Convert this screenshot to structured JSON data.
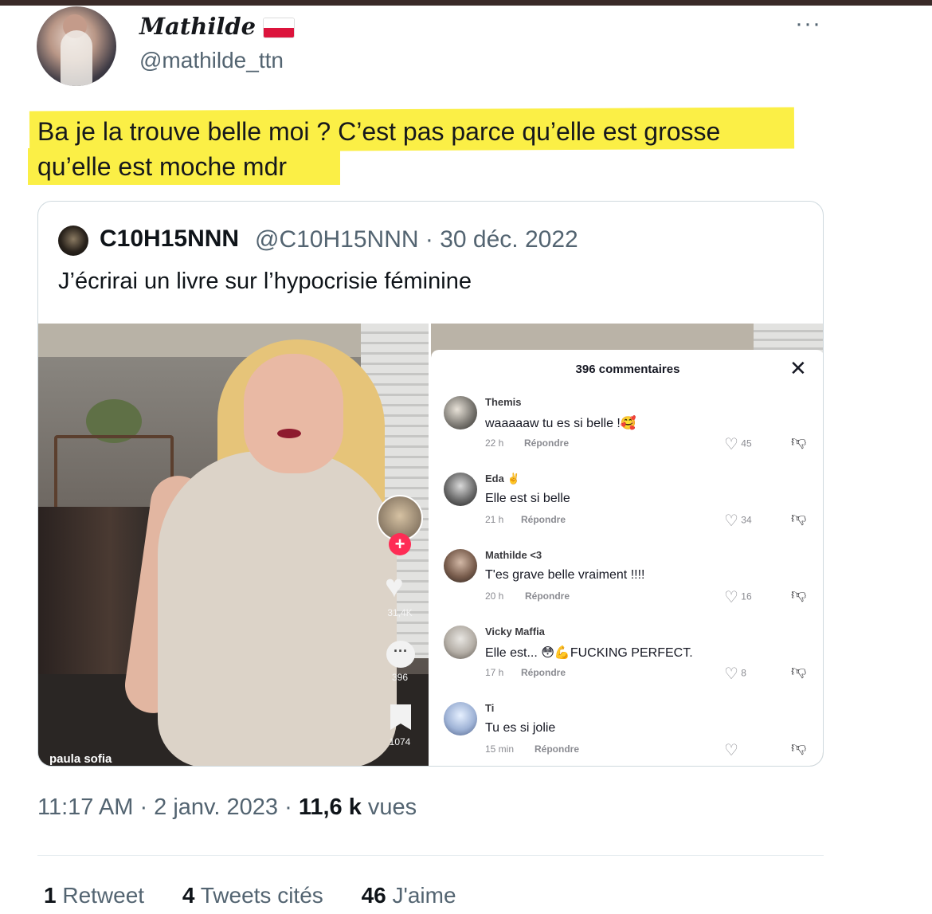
{
  "author": {
    "name": "Mathilde",
    "handle": "@mathilde_ttn",
    "flag_icon": "poland-flag-icon"
  },
  "tweet": {
    "line1": "Ba je la trouve belle moi ? C’est pas parce qu’elle est grosse",
    "line2": "qu’elle est moche mdr",
    "highlight_color": "#fbef46"
  },
  "quoted": {
    "name": "C10H15NNN",
    "handle": "@C10H15NNN",
    "separator": "·",
    "date": "30 déc. 2022",
    "text": "J’écrirai un livre sur l’hypocrisie féminine",
    "video": {
      "likes": "31,4K",
      "comments": "396",
      "saves": "1074",
      "username": "paula sofia"
    },
    "comments_panel": {
      "title": "396 commentaires",
      "reply_label": "Répondre",
      "comments": [
        {
          "user": "Themis",
          "text": "waaaaaw tu es si belle !🥰",
          "time": "22 h",
          "likes": "45"
        },
        {
          "user": "Eda ✌️",
          "text": "Elle est si belle",
          "time": "21 h",
          "likes": "34"
        },
        {
          "user": "Mathilde <3",
          "text": "T'es grave belle vraiment !!!!",
          "time": "20 h",
          "likes": "16"
        },
        {
          "user": "Vicky Maffia",
          "text": "Elle est... 😳💪FUCKING PERFECT.",
          "time": "17 h",
          "likes": "8"
        },
        {
          "user": "Ti",
          "text": "Tu es si jolie",
          "time": "15 min",
          "likes": ""
        }
      ]
    }
  },
  "meta": {
    "time": "11:17 AM",
    "date": "2 janv. 2023",
    "views_count": "11,6 k",
    "views_label": "vues"
  },
  "stats": {
    "retweets_count": "1",
    "retweets_label": "Retweet",
    "quotes_count": "4",
    "quotes_label": "Tweets cités",
    "likes_count": "46",
    "likes_label": "J'aime"
  }
}
